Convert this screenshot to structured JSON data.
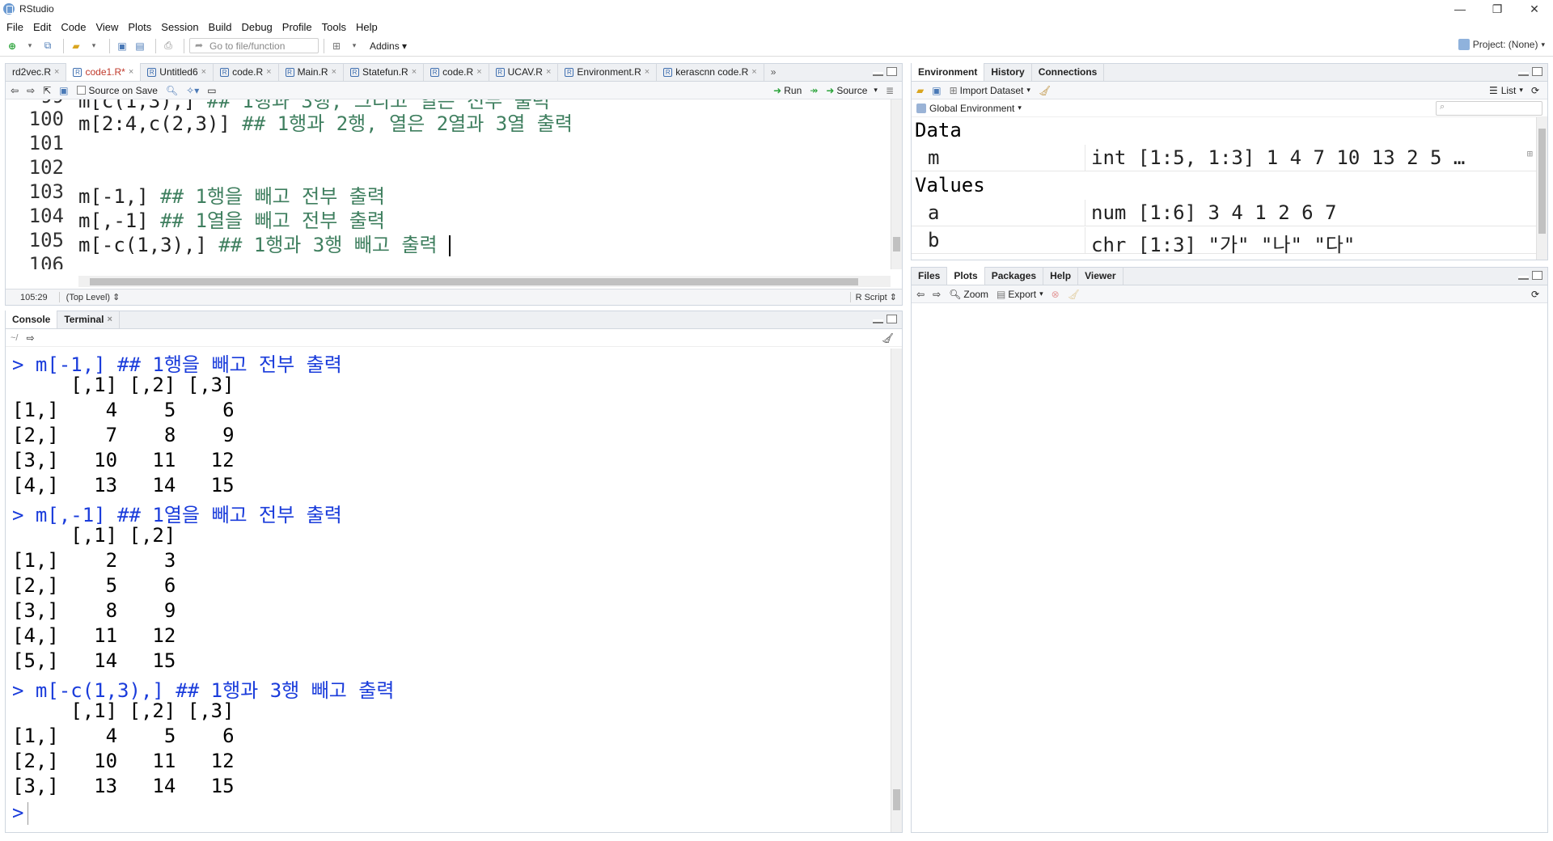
{
  "window": {
    "title": "RStudio",
    "controls": [
      "—",
      "❐",
      "✕"
    ]
  },
  "menu": [
    "File",
    "Edit",
    "Code",
    "View",
    "Plots",
    "Session",
    "Build",
    "Debug",
    "Profile",
    "Tools",
    "Help"
  ],
  "toolbar": {
    "goto_placeholder": "Go to file/function",
    "addins": "Addins",
    "project": "Project: (None)"
  },
  "editor": {
    "tabs": [
      {
        "label": "rd2vec.R",
        "active": false
      },
      {
        "label": "code1.R*",
        "active": true
      },
      {
        "label": "Untitled6",
        "active": false
      },
      {
        "label": "code.R",
        "active": false
      },
      {
        "label": "Main.R",
        "active": false
      },
      {
        "label": "Statefun.R",
        "active": false
      },
      {
        "label": "code.R",
        "active": false
      },
      {
        "label": "UCAV.R",
        "active": false
      },
      {
        "label": "Environment.R",
        "active": false
      },
      {
        "label": "kerascnn code.R",
        "active": false
      }
    ],
    "source_on_save": "Source on Save",
    "run": "Run",
    "source": "Source",
    "lines": [
      {
        "n": "100",
        "code": "m[2:4,c(2,3)]",
        "comment": " ## 1행과 2행, 열은 2열과 3열 출력"
      },
      {
        "n": "101",
        "code": "",
        "comment": ""
      },
      {
        "n": "102",
        "code": "",
        "comment": ""
      },
      {
        "n": "103",
        "code": "m[-1,]",
        "comment": " ## 1행을 빼고 전부 출력"
      },
      {
        "n": "104",
        "code": "m[,-1]",
        "comment": " ## 1열을 빼고 전부 출력"
      },
      {
        "n": "105",
        "code": "m[-c(1,3),]",
        "comment": " ## 1행과 3행 빼고 출력"
      },
      {
        "n": "106",
        "code": "",
        "comment": ""
      }
    ],
    "status": {
      "position": "105:29",
      "scope": "(Top Level)",
      "filetype": "R Script"
    }
  },
  "console": {
    "tabs": [
      "Console",
      "Terminal"
    ],
    "path": "~/",
    "lines": [
      {
        "t": "> m[-1,] ## 1행을 빼고 전부 출력",
        "cmd": true
      },
      {
        "t": "     [,1] [,2] [,3]",
        "cmd": false
      },
      {
        "t": "[1,]    4    5    6",
        "cmd": false
      },
      {
        "t": "[2,]    7    8    9",
        "cmd": false
      },
      {
        "t": "[3,]   10   11   12",
        "cmd": false
      },
      {
        "t": "[4,]   13   14   15",
        "cmd": false
      },
      {
        "t": "> m[,-1] ## 1열을 빼고 전부 출력",
        "cmd": true
      },
      {
        "t": "     [,1] [,2]",
        "cmd": false
      },
      {
        "t": "[1,]    2    3",
        "cmd": false
      },
      {
        "t": "[2,]    5    6",
        "cmd": false
      },
      {
        "t": "[3,]    8    9",
        "cmd": false
      },
      {
        "t": "[4,]   11   12",
        "cmd": false
      },
      {
        "t": "[5,]   14   15",
        "cmd": false
      },
      {
        "t": "> m[-c(1,3),] ## 1행과 3행 빼고 출력",
        "cmd": true
      },
      {
        "t": "     [,1] [,2] [,3]",
        "cmd": false
      },
      {
        "t": "[1,]    4    5    6",
        "cmd": false
      },
      {
        "t": "[2,]   10   11   12",
        "cmd": false
      },
      {
        "t": "[3,]   13   14   15",
        "cmd": false
      },
      {
        "t": "> ",
        "cmd": true
      }
    ]
  },
  "environment": {
    "tabs": [
      "Environment",
      "History",
      "Connections"
    ],
    "import_dataset": "Import Dataset",
    "list_view": "List",
    "scope": "Global Environment",
    "data_header": "Data",
    "values_header": "Values",
    "data": [
      {
        "name": "m",
        "value": "int [1:5, 1:3] 1 4 7 10 13 2 5 …"
      }
    ],
    "values": [
      {
        "name": "a",
        "value": "num [1:6] 3 4 1 2 6 7"
      },
      {
        "name": "b",
        "value": "chr [1:3] \"가\" \"나\" \"다\""
      }
    ]
  },
  "files": {
    "tabs": [
      "Files",
      "Plots",
      "Packages",
      "Help",
      "Viewer"
    ],
    "zoom": "Zoom",
    "export": "Export"
  }
}
